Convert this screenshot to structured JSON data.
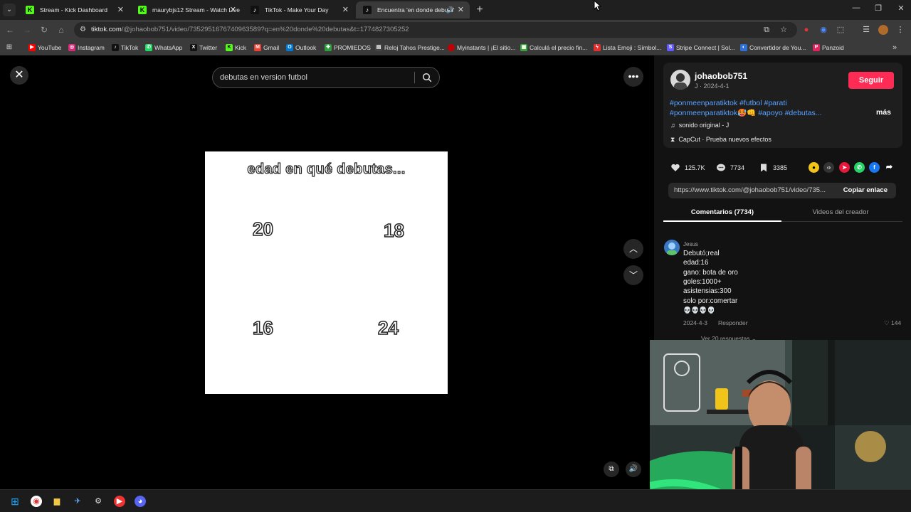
{
  "browser": {
    "tabs": [
      {
        "title": "Stream - Kick Dashboard",
        "favicon": "kick-icon",
        "active": false
      },
      {
        "title": "maurybjs12 Stream - Watch Live",
        "favicon": "kick-icon",
        "active": false
      },
      {
        "title": "TikTok - Make Your Day",
        "favicon": "tiktok-icon",
        "active": false
      },
      {
        "title": "Encuentra 'en donde debuta'",
        "favicon": "tiktok-icon",
        "active": true
      }
    ],
    "url": {
      "host": "tiktok.com",
      "path": "/@johaobob751/video/7352951676740963589?q=en%20donde%20debutas&t=1774827305252"
    },
    "bookmarks": [
      {
        "label": "YouTube",
        "color": "#ff0000"
      },
      {
        "label": "Instagram",
        "color": "#d62976"
      },
      {
        "label": "TikTok",
        "color": "#111111"
      },
      {
        "label": "WhatsApp",
        "color": "#25d366"
      },
      {
        "label": "Twitter",
        "color": "#111111"
      },
      {
        "label": "Kick",
        "color": "#53fc18"
      },
      {
        "label": "Gmail",
        "color": "#ea4335"
      },
      {
        "label": "Outlook",
        "color": "#0078d4"
      },
      {
        "label": "PROMIEDOS",
        "color": "#2e9e3e"
      },
      {
        "label": "Reloj Tahos Prestige...",
        "color": "#444444"
      },
      {
        "label": "Myinstants | ¡El sitio...",
        "color": "#c00000"
      },
      {
        "label": "Calculá el precio fin...",
        "color": "#3ca33c"
      },
      {
        "label": "Lista Emoji : Símbol...",
        "color": "#e03030"
      },
      {
        "label": "Stripe Connect | Sol...",
        "color": "#635bff"
      },
      {
        "label": "Convertidor de You...",
        "color": "#2f6fd6"
      },
      {
        "label": "Panzoid",
        "color": "#e0245e"
      }
    ]
  },
  "player": {
    "search_text": "debutas en version futbol",
    "overlay_title": "edad en qué debutas...",
    "options": [
      "20",
      "18",
      "16",
      "24"
    ]
  },
  "post": {
    "username": "johaobob751",
    "user_meta": "J · 2024-4-1",
    "follow_label": "Seguir",
    "description": "#ponmeenparatiktok #futbol #parati #ponmeenparatiktok🥵👊 #apoyo #debutas...",
    "more_label": "más",
    "sound": "sonido original - J",
    "effect": "CapCut · Prueba nuevos efectos",
    "likes": "125.7K",
    "comments": "7734",
    "saves": "3385",
    "link": "https://www.tiktok.com/@johaobob751/video/735...",
    "copy_label": "Copiar enlace",
    "tab_comments": "Comentarios (7734)",
    "tab_videos": "Videos del creador"
  },
  "comment": {
    "author": "Jesus",
    "lines": [
      "Debutó;real",
      "edad:16",
      "gano: bota de oro",
      "goles:1000+",
      "asistensias:300",
      "solo por:comertar",
      "💀💀💀💀"
    ],
    "date": "2024-4-3",
    "reply_label": "Responder",
    "likes": "144",
    "replies_label": "Ver 20 respuestas ⌄"
  },
  "colors": {
    "accent": "#fe2c55",
    "hashtag": "#5aa2ff"
  }
}
